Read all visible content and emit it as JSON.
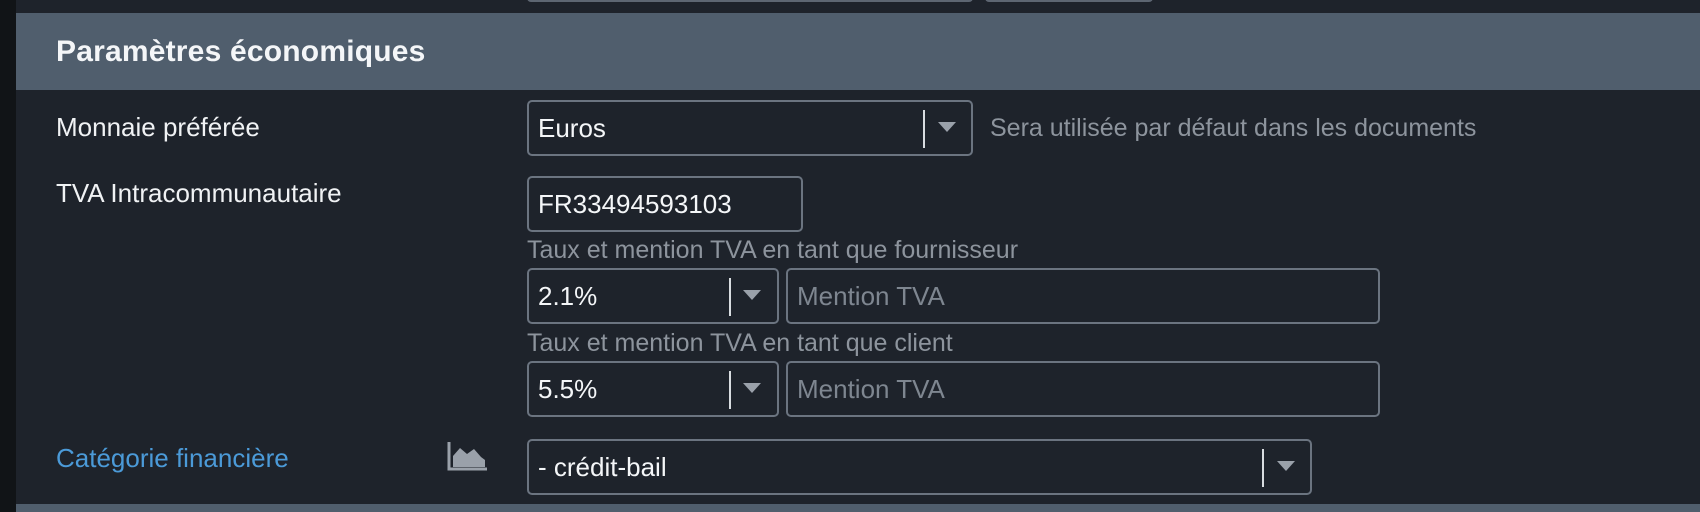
{
  "section": {
    "title": "Paramètres économiques"
  },
  "currency": {
    "label": "Monnaie préférée",
    "value": "Euros",
    "hint": "Sera utilisée par défaut dans les documents"
  },
  "vat": {
    "label": "TVA Intracommunautaire",
    "number_value": "FR33494593103",
    "supplier": {
      "caption": "Taux et mention TVA en tant que fournisseur",
      "rate": "2.1%",
      "mention_placeholder": "Mention TVA"
    },
    "client": {
      "caption": "Taux et mention TVA en tant que client",
      "rate": "5.5%",
      "mention_placeholder": "Mention TVA"
    }
  },
  "financial_category": {
    "label": "Catégorie financière",
    "value": "- crédit-bail",
    "icon": "area-chart-icon"
  },
  "colors": {
    "header_bg": "#505e6d",
    "panel_bg": "#1e232b",
    "link": "#4b9ad8"
  }
}
